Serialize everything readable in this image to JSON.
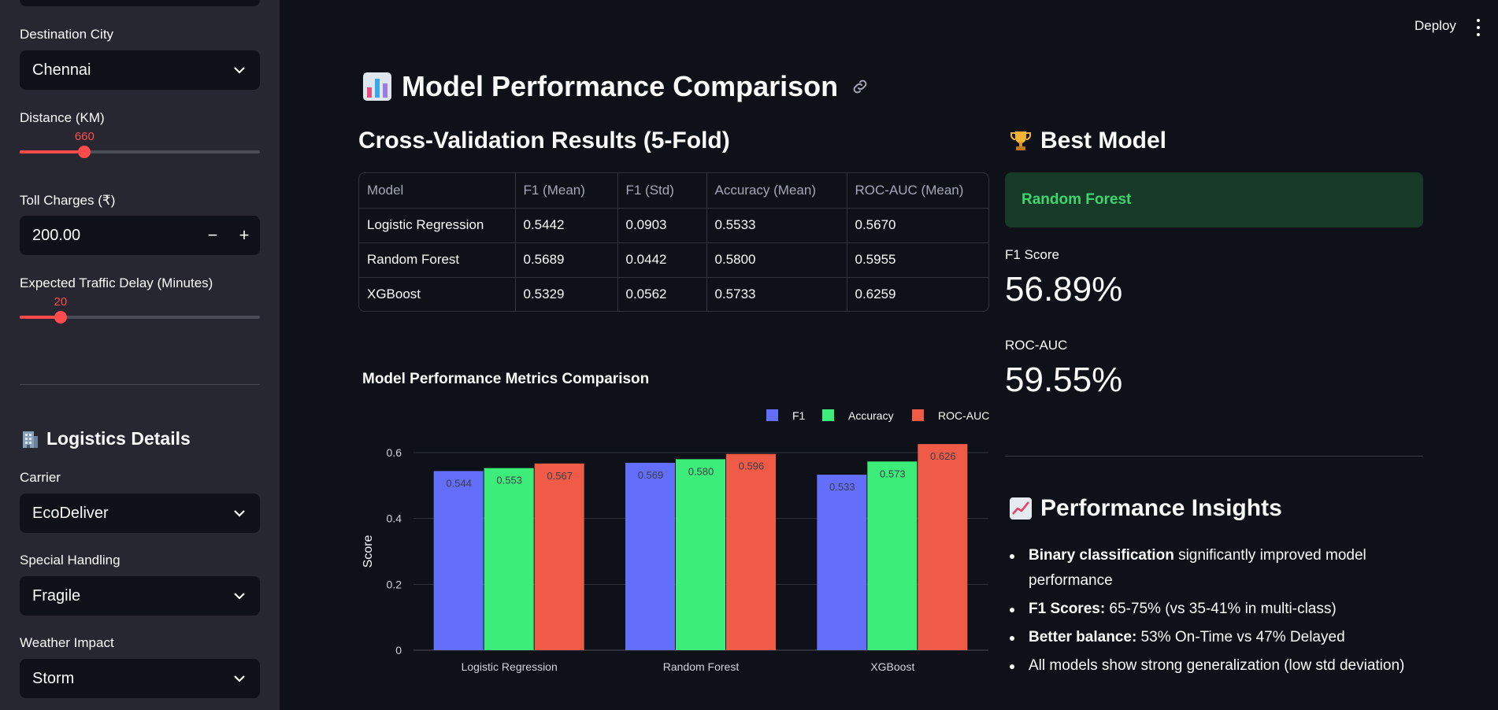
{
  "sidebar": {
    "destination_city": {
      "label": "Destination City",
      "value": "Chennai"
    },
    "distance": {
      "label": "Distance (KM)",
      "value": "660",
      "fraction": 0.27
    },
    "toll": {
      "label": "Toll Charges (₹)",
      "value": "200.00",
      "minus": "−",
      "plus": "+"
    },
    "traffic_delay": {
      "label": "Expected Traffic Delay (Minutes)",
      "value": "20",
      "fraction": 0.17
    },
    "logistics_heading": "Logistics Details",
    "carrier": {
      "label": "Carrier",
      "value": "EcoDeliver"
    },
    "special_handling": {
      "label": "Special Handling",
      "value": "Fragile"
    },
    "weather": {
      "label": "Weather Impact",
      "value": "Storm"
    }
  },
  "topbar": {
    "deploy": "Deploy"
  },
  "main": {
    "title": "Model Performance Comparison",
    "cv_heading": "Cross-Validation Results (5-Fold)",
    "table": {
      "headers": [
        "Model",
        "F1 (Mean)",
        "F1 (Std)",
        "Accuracy (Mean)",
        "ROC-AUC (Mean)"
      ],
      "rows": [
        [
          "Logistic Regression",
          "0.5442",
          "0.0903",
          "0.5533",
          "0.5670"
        ],
        [
          "Random Forest",
          "0.5689",
          "0.0442",
          "0.5800",
          "0.5955"
        ],
        [
          "XGBoost",
          "0.5329",
          "0.0562",
          "0.5733",
          "0.6259"
        ]
      ]
    },
    "chart_title": "Model Performance Metrics Comparison"
  },
  "chart_data": {
    "type": "bar",
    "title": "Model Performance Metrics Comparison",
    "xlabel": "",
    "ylabel": "Score",
    "categories": [
      "Logistic Regression",
      "Random Forest",
      "XGBoost"
    ],
    "series": [
      {
        "name": "F1",
        "color": "#636efa",
        "values": [
          0.544,
          0.569,
          0.533
        ],
        "labels": [
          "0.544",
          "0.569",
          "0.533"
        ]
      },
      {
        "name": "Accuracy",
        "color": "#3ded7a",
        "values": [
          0.553,
          0.58,
          0.573
        ],
        "labels": [
          "0.553",
          "0.580",
          "0.573"
        ]
      },
      {
        "name": "ROC-AUC",
        "color": "#ef5b47",
        "values": [
          0.567,
          0.596,
          0.626
        ],
        "labels": [
          "0.567",
          "0.596",
          "0.626"
        ]
      }
    ],
    "yticks": [
      "0",
      "0.2",
      "0.4",
      "0.6"
    ],
    "ylim": [
      0,
      0.6
    ],
    "grid": true,
    "legend": "top-right"
  },
  "right": {
    "best_heading": "Best Model",
    "best_model": "Random Forest",
    "f1_label": "F1 Score",
    "f1_value": "56.89%",
    "roc_label": "ROC-AUC",
    "roc_value": "59.55%",
    "insights_heading": "Performance Insights",
    "insights": [
      {
        "bold": "Binary classification",
        "text": " significantly improved model performance"
      },
      {
        "bold": "F1 Scores:",
        "text": " 65-75% (vs 35-41% in multi-class)"
      },
      {
        "bold": "Better balance:",
        "text": " 53% On-Time vs 47% Delayed"
      },
      {
        "bold": "",
        "text": "All models show strong generalization (low std deviation)"
      }
    ]
  }
}
